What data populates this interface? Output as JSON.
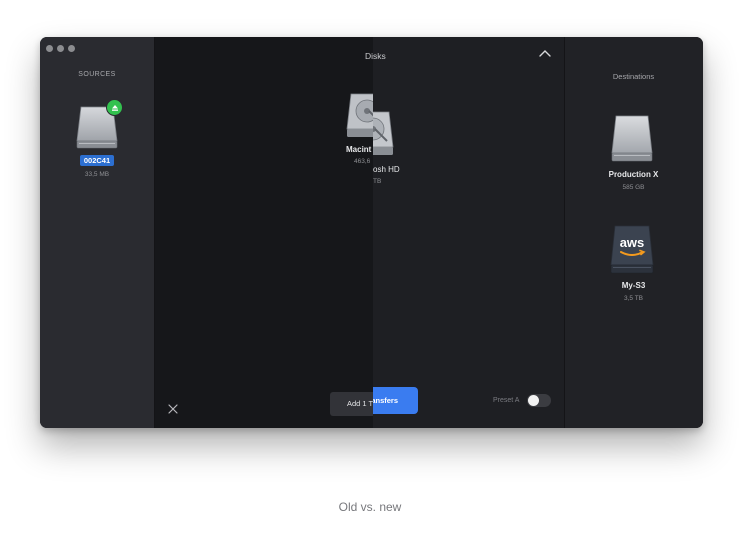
{
  "sidebar": {
    "title": "SOURCES",
    "source": {
      "label": "002C41",
      "size": "33,5 MB",
      "icon": "hard-drive-icon",
      "badge": "eject-icon"
    }
  },
  "center": {
    "title_old": "Di",
    "title_new": "sks",
    "collapse_icon": "chevron-up-icon",
    "disk_old": {
      "name": "Macint",
      "size": "463,6"
    },
    "disk_new": {
      "name": "osh HD",
      "size": "TB"
    },
    "close_icon": "close-icon",
    "add_label": "Add 1 T",
    "transfer_label": "ansfers",
    "preset_label": "Preset A",
    "preset_toggle_on": false
  },
  "destinations": {
    "title": "Destinations",
    "items": [
      {
        "name": "Production X",
        "size": "585 GB",
        "icon": "hard-drive-icon"
      },
      {
        "name": "My-S3",
        "size": "3,5 TB",
        "icon": "aws-icon",
        "logo_text": "aws"
      }
    ]
  },
  "caption": "Old vs. new",
  "colors": {
    "accent": "#3a7cf0",
    "selection": "#2c6fd1",
    "eject": "#33c24f"
  }
}
